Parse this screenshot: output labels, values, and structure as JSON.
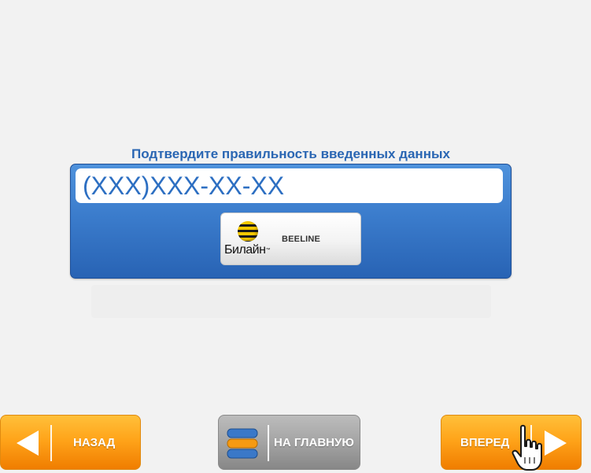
{
  "confirm": {
    "title": "Подтвердите правильность введенных данных",
    "phone_mask": "(XXX)XXX-XX-XX"
  },
  "operator": {
    "logo_text": "Билайн",
    "logo_tm": "™",
    "name": "BEELINE",
    "logo_icon": "beeline-striped-ball-icon",
    "colors": {
      "yellow": "#f6c800",
      "black": "#1a1a1a"
    }
  },
  "nav": {
    "back_label": "НАЗАД",
    "home_label": "НА ГЛАВНУЮ",
    "forward_label": "ВПЕРЕД",
    "back_icon": "arrow-left-icon",
    "home_icon": "home-stack-icon",
    "forward_icon": "arrow-right-icon",
    "colors": {
      "orange": "#ffa41a",
      "gray": "#a4a4a4",
      "blue": "#3b7ccc"
    }
  },
  "pointer": {
    "icon": "hand-pointer-icon"
  }
}
